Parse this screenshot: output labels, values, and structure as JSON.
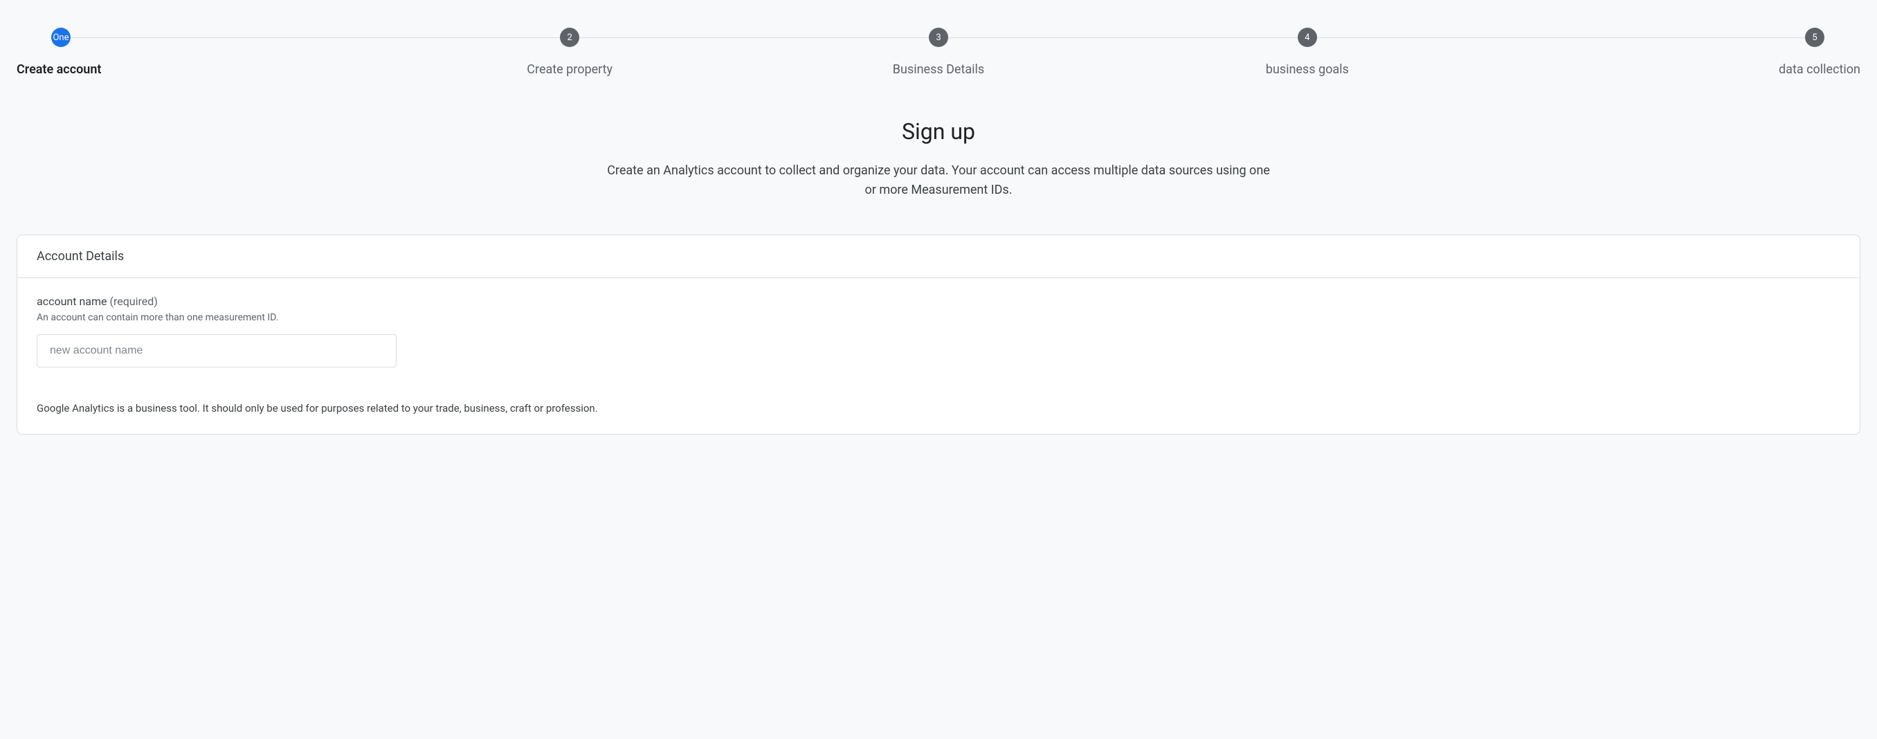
{
  "stepper": {
    "steps": [
      {
        "badge": "One",
        "label": "Create account",
        "active": true
      },
      {
        "badge": "2",
        "label": "Create property",
        "active": false
      },
      {
        "badge": "3",
        "label": "Business Details",
        "active": false
      },
      {
        "badge": "4",
        "label": "business goals",
        "active": false
      },
      {
        "badge": "5",
        "label": "data collection",
        "active": false
      }
    ]
  },
  "heading": {
    "title": "Sign up",
    "subtitle": "Create an Analytics account to collect and organize your data. Your account can access multiple data sources using one or more Measurement IDs."
  },
  "card": {
    "header": "Account Details",
    "account_name_label": "account name",
    "account_name_required": " (required)",
    "account_name_hint": "An account can contain more than one measurement ID.",
    "account_name_placeholder": "new account name",
    "account_name_value": "",
    "disclaimer": "Google Analytics is a business tool. It should only be used for purposes related to your trade, business, craft or profession."
  }
}
